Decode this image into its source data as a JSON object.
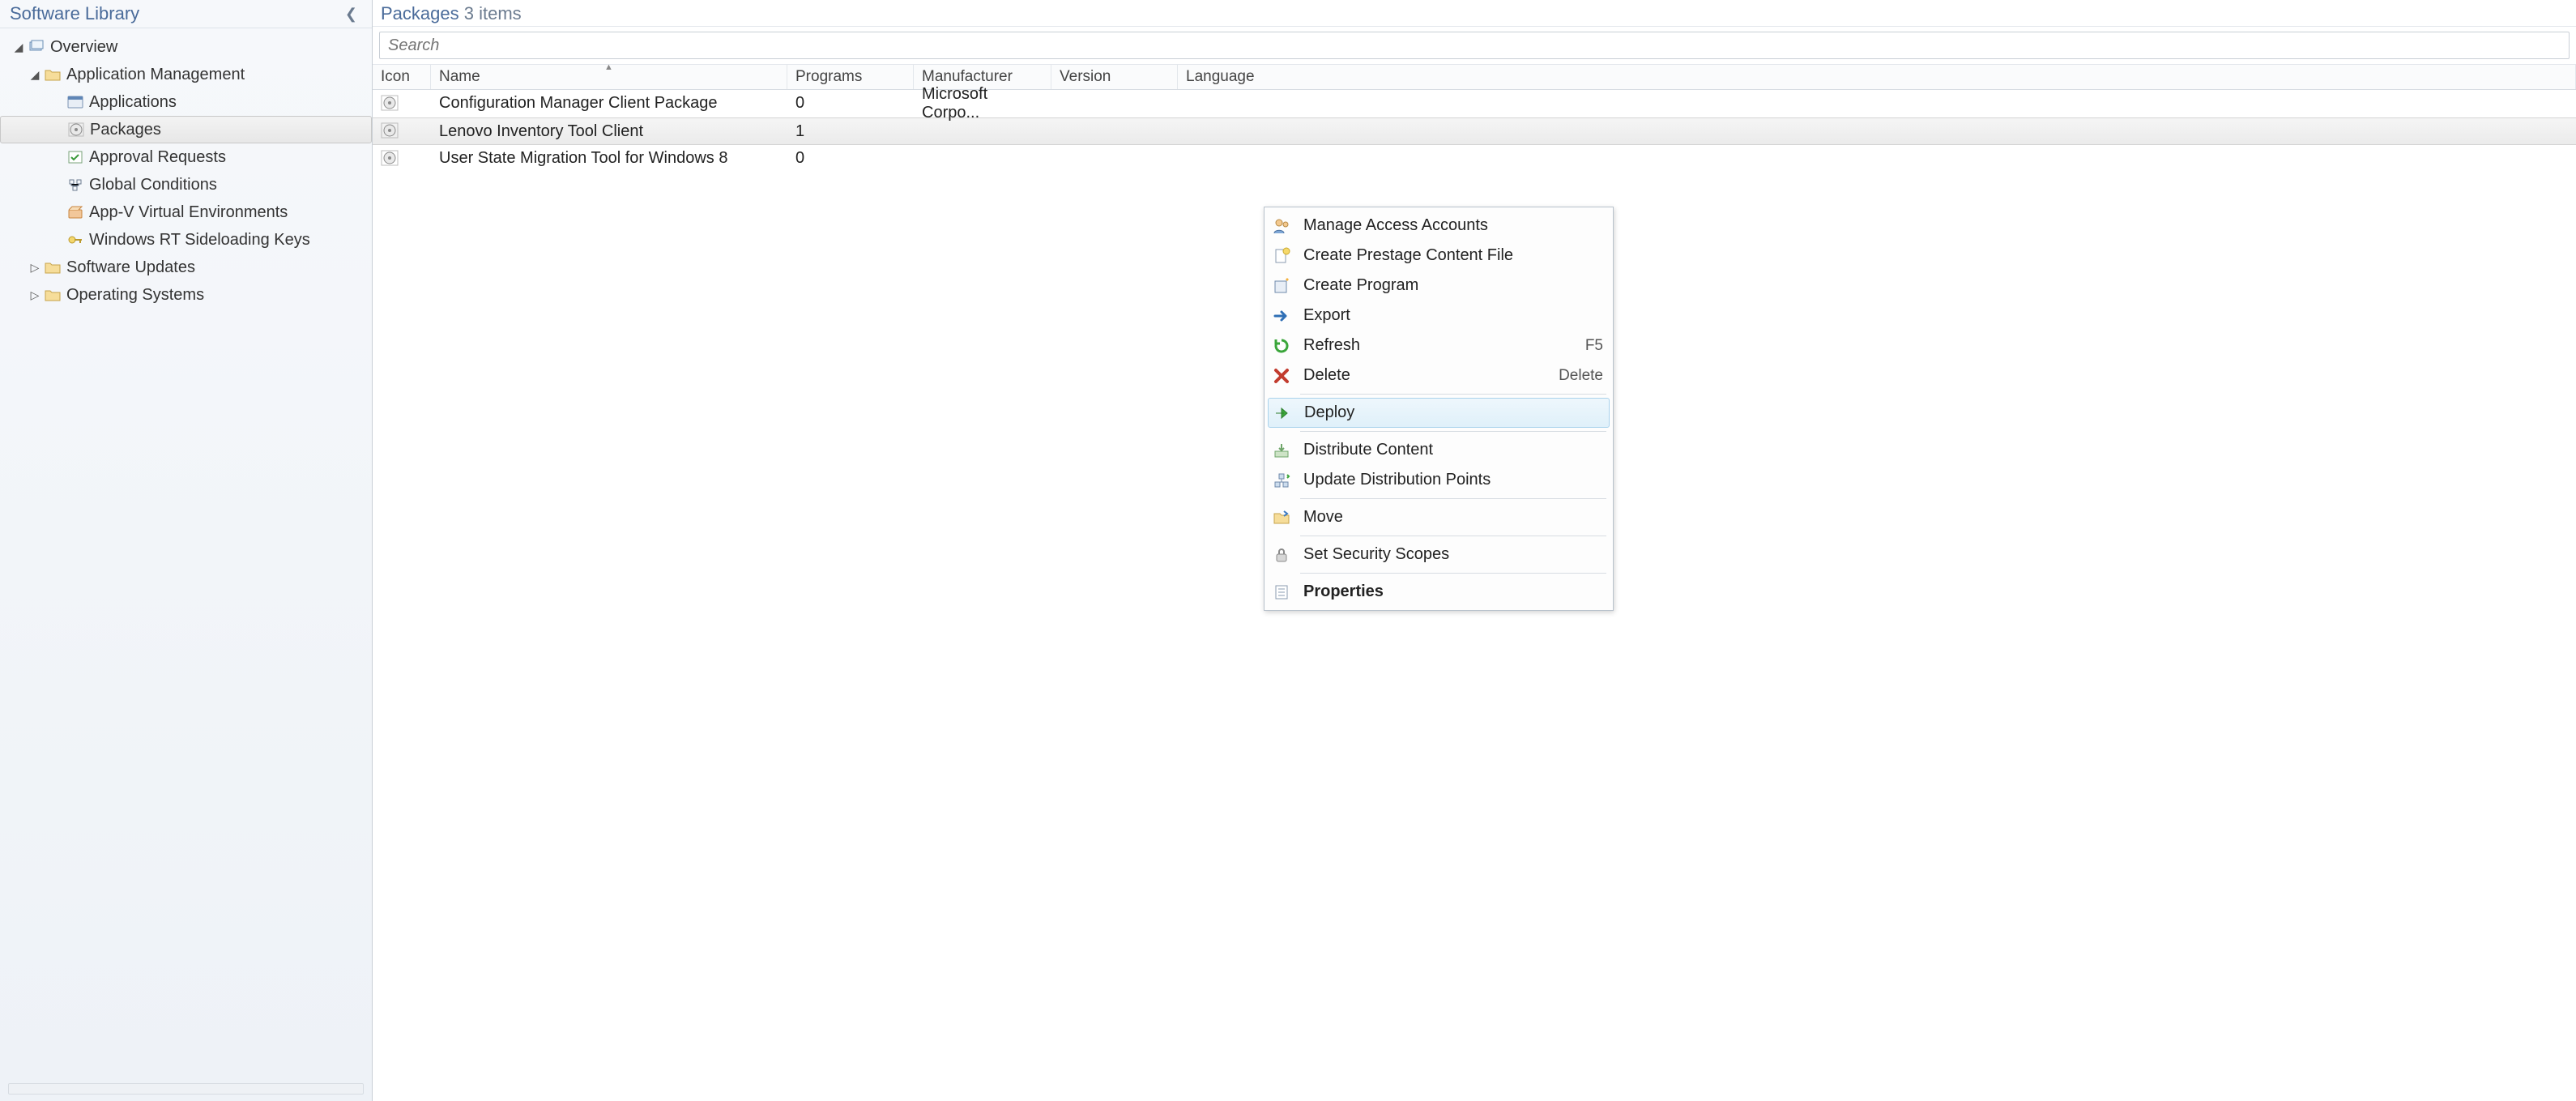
{
  "sidebar": {
    "title": "Software Library",
    "items": [
      {
        "label": "Overview",
        "indent": 0,
        "toggle": "expanded",
        "icon": "overview"
      },
      {
        "label": "Application Management",
        "indent": 1,
        "toggle": "expanded",
        "icon": "folder"
      },
      {
        "label": "Applications",
        "indent": 2,
        "toggle": "none",
        "icon": "app"
      },
      {
        "label": "Packages",
        "indent": 2,
        "toggle": "none",
        "icon": "package",
        "selected": true
      },
      {
        "label": "Approval Requests",
        "indent": 2,
        "toggle": "none",
        "icon": "approval"
      },
      {
        "label": "Global Conditions",
        "indent": 2,
        "toggle": "none",
        "icon": "conditions"
      },
      {
        "label": "App-V Virtual Environments",
        "indent": 2,
        "toggle": "none",
        "icon": "appv"
      },
      {
        "label": "Windows RT Sideloading Keys",
        "indent": 2,
        "toggle": "none",
        "icon": "key"
      },
      {
        "label": "Software Updates",
        "indent": 1,
        "toggle": "collapsed",
        "icon": "folder"
      },
      {
        "label": "Operating Systems",
        "indent": 1,
        "toggle": "collapsed",
        "icon": "folder"
      }
    ]
  },
  "main": {
    "heading_prefix": "Packages",
    "heading_count": "3 items",
    "search_placeholder": "Search",
    "columns": {
      "icon": "Icon",
      "name": "Name",
      "programs": "Programs",
      "manufacturer": "Manufacturer",
      "version": "Version",
      "language": "Language"
    },
    "rows": [
      {
        "name": "Configuration Manager Client Package",
        "programs": "0",
        "manufacturer": "Microsoft Corpo...",
        "version": "",
        "language": ""
      },
      {
        "name": "Lenovo Inventory Tool Client",
        "programs": "1",
        "manufacturer": "",
        "version": "",
        "language": "",
        "selected": true
      },
      {
        "name": "User State Migration Tool for Windows 8",
        "programs": "0",
        "manufacturer": "",
        "version": "",
        "language": ""
      }
    ]
  },
  "context_menu": {
    "items": [
      {
        "label": "Manage Access Accounts",
        "icon": "users"
      },
      {
        "label": "Create Prestage Content File",
        "icon": "file-new"
      },
      {
        "label": "Create Program",
        "icon": "program-new"
      },
      {
        "label": "Export",
        "icon": "export"
      },
      {
        "label": "Refresh",
        "icon": "refresh",
        "shortcut": "F5"
      },
      {
        "label": "Delete",
        "icon": "delete",
        "shortcut": "Delete"
      },
      {
        "sep": true
      },
      {
        "label": "Deploy",
        "icon": "deploy",
        "hover": true
      },
      {
        "sep": true
      },
      {
        "label": "Distribute Content",
        "icon": "distribute"
      },
      {
        "label": "Update Distribution Points",
        "icon": "update-points"
      },
      {
        "sep": true
      },
      {
        "label": "Move",
        "icon": "move"
      },
      {
        "sep": true
      },
      {
        "label": "Set Security Scopes",
        "icon": "lock"
      },
      {
        "sep": true
      },
      {
        "label": "Properties",
        "icon": "properties",
        "bold": true
      }
    ]
  }
}
